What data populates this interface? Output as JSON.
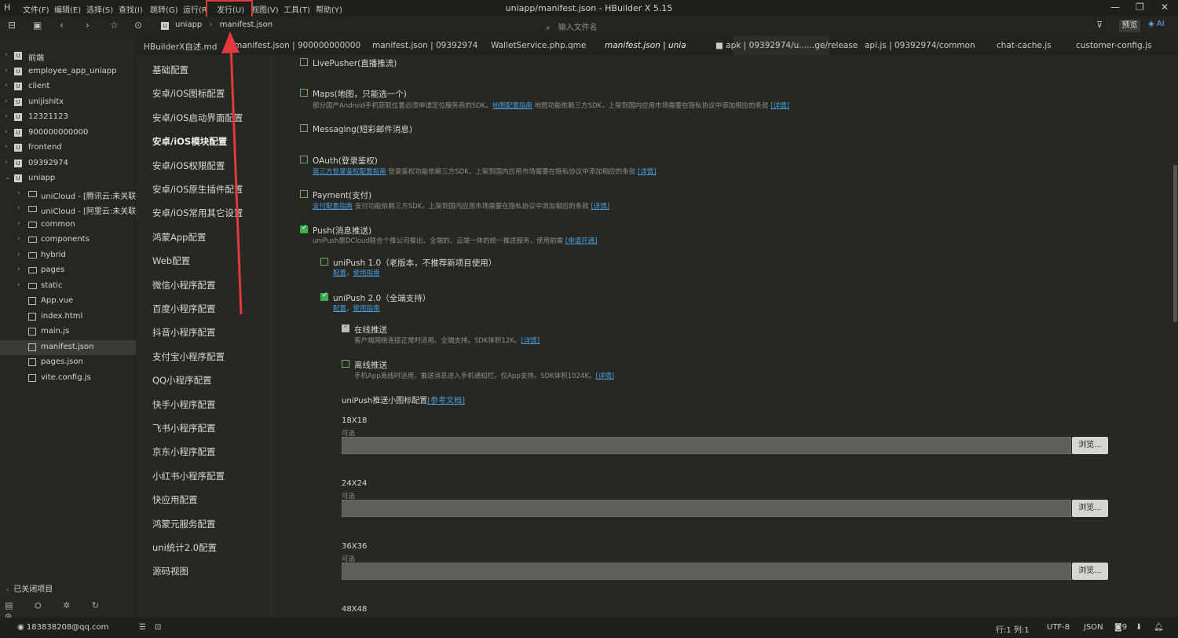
{
  "menu": {
    "items": [
      "文件(F)",
      "编辑(E)",
      "选择(S)",
      "查找(I)",
      "跳转(G)",
      "运行(R)",
      "发行(U)",
      "视图(V)",
      "工具(T)",
      "帮助(Y)"
    ],
    "highlighted": "发行(U)"
  },
  "window": {
    "title": "uniapp/manifest.json - HBuilder X 5.15"
  },
  "toolbar": {
    "breadcrumb": [
      "uniapp",
      "manifest.json"
    ],
    "search_placeholder": "输入文件名",
    "preview_label": "预览",
    "ai_label": "AI"
  },
  "tabs": [
    "HBuilderX自述.md",
    "manifest.json | 900000000000",
    "manifest.json | 09392974",
    "WalletService.php.qme",
    "manifest.json | uniapp",
    "apk | 09392974/u......ge/release",
    "api.js | 09392974/common",
    "chat-cache.js",
    "customer-config.js"
  ],
  "active_tab": "manifest.json | uniapp",
  "sidebar": {
    "projects": [
      "前端",
      "employee_app_uniapp",
      "client",
      "unijishitx",
      "12321123",
      "900000000000",
      "frontend",
      "09392974",
      "uniapp"
    ],
    "uniapp_children": [
      "uniCloud - [腾讯云:未关联云",
      "uniCloud - [阿里云:未关联云",
      "common",
      "components",
      "hybrid",
      "pages",
      "static",
      "App.vue",
      "index.html",
      "main.js",
      "manifest.json",
      "pages.json",
      "vite.config.js"
    ],
    "selected": "manifest.json",
    "closed_projects": "已关闭项目"
  },
  "nav": {
    "items": [
      "基础配置",
      "安卓/iOS图标配置",
      "安卓/iOS启动界面配置",
      "安卓/iOS模块配置",
      "安卓/iOS权限配置",
      "安卓/iOS原生插件配置",
      "安卓/iOS常用其它设置",
      "鸿蒙App配置",
      "Web配置",
      "微信小程序配置",
      "百度小程序配置",
      "抖音小程序配置",
      "支付宝小程序配置",
      "QQ小程序配置",
      "快手小程序配置",
      "飞书小程序配置",
      "京东小程序配置",
      "小红书小程序配置",
      "快应用配置",
      "鸿蒙元服务配置",
      "uni统计2.0配置",
      "源码视图"
    ],
    "active": "安卓/iOS模块配置"
  },
  "modules": {
    "livepusher": "LivePusher(直播推流)",
    "maps": "Maps(地图，只能选一个)",
    "maps_desc": "部分国产Android手机获取位置必须申请定位服务商的SDK。",
    "maps_link": "地图配置指南",
    "maps_desc2": " 地图功能依赖三方SDK，上架到国内应用市场需要在隐私协议中添加相应的条款 ",
    "detail": "[详情]",
    "messaging": "Messaging(短彩邮件消息)",
    "oauth": "OAuth(登录鉴权)",
    "oauth_link": "第三方登录鉴权配置指南",
    "oauth_desc": " 登录鉴权功能依赖三方SDK，上架到国内应用市场需要在隐私协议中添加相应的条款 ",
    "payment": "Payment(支付)",
    "payment_link": "支付配置指南",
    "payment_desc": " 支付功能依赖三方SDK，上架到国内应用市场需要在隐私协议中添加相应的条款 ",
    "push": "Push(消息推送)",
    "push_desc": "uniPush是DCloud联合个推公司推出、全端的、云端一体的统一推送服务，使用前需 ",
    "push_link": "[申请开通]",
    "unipush1": "uniPush 1.0（老版本，不推荐新项目使用）",
    "unipush2": "uniPush 2.0（全端支持）",
    "config_link": "配置",
    "sep": "，",
    "guide_link": "使用指南",
    "online": "在线推送",
    "online_desc": "客户端网络连接正常时适用。全端支持。SDK体积12K。",
    "offline": "离线推送",
    "offline_desc": "手机App离线时适用，推送消息进入手机通知栏。仅App支持。SDK体积1024K。",
    "icon_title": "uniPush推送小图标配置",
    "icon_ref": "[参考文档]",
    "sizes": [
      "18X18",
      "24X24",
      "36X36",
      "48X48"
    ],
    "optional": "可选",
    "browse": "浏览..."
  },
  "statusbar": {
    "user": "183838208@qq.com",
    "position": "行:1  列:1",
    "encoding": "UTF-8",
    "language": "JSON",
    "count": "9"
  }
}
